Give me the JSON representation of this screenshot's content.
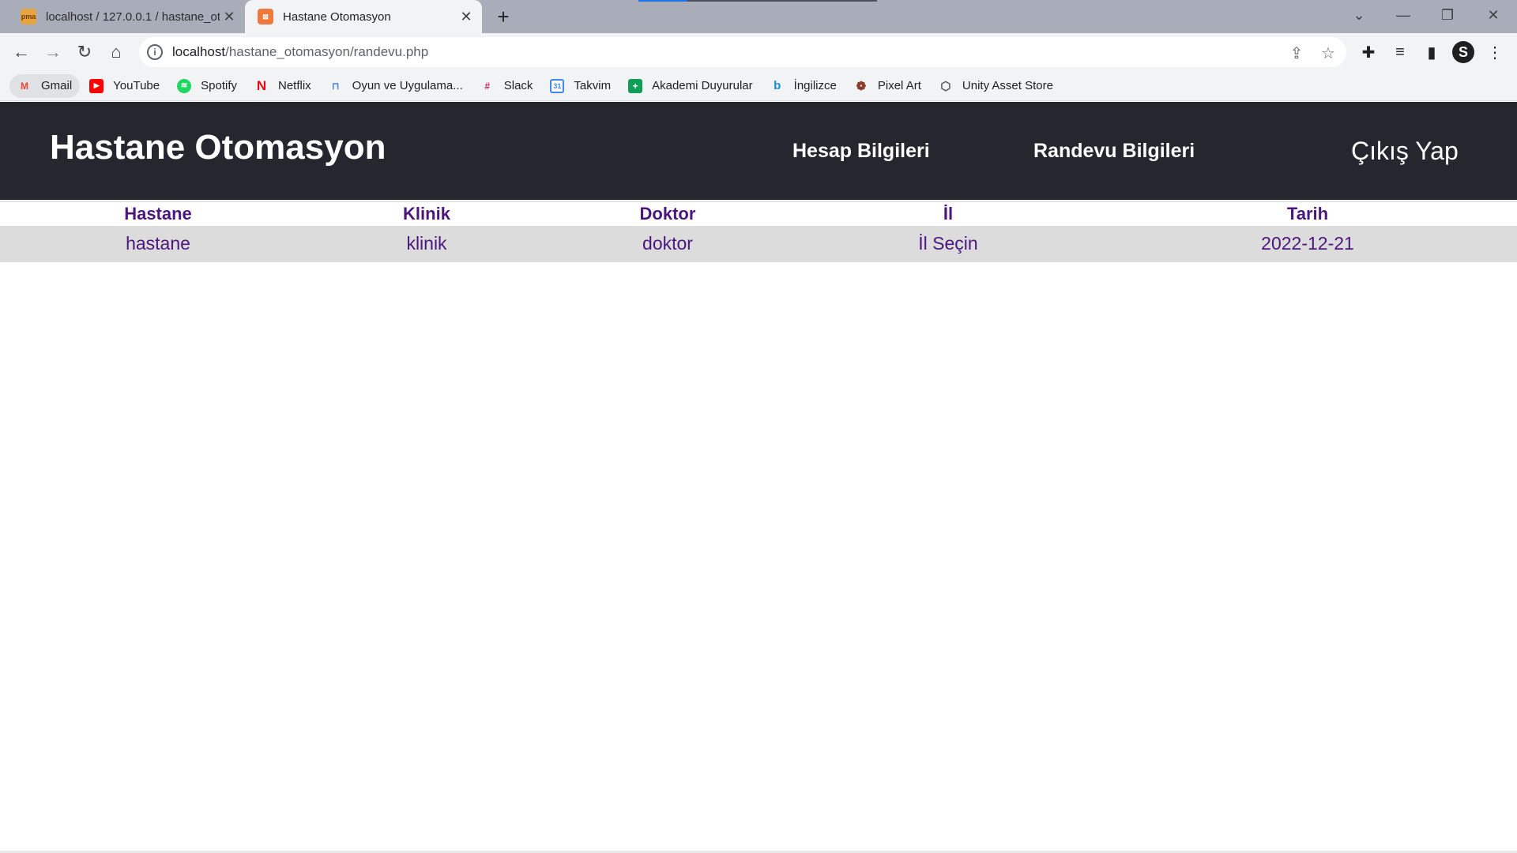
{
  "browser": {
    "tabs": [
      {
        "title": "localhost / 127.0.0.1 / hastane_ot",
        "favicon": "pma",
        "active": false
      },
      {
        "title": "Hastane Otomasyon",
        "favicon": "xampp",
        "active": true
      }
    ],
    "new_tab_symbol": "+",
    "address": {
      "host": "localhost",
      "path": "/hastane_otomasyon/randevu.php"
    },
    "profile_initial": "S",
    "bookmarks": [
      {
        "label": "Gmail",
        "icon": "gmail-icon"
      },
      {
        "label": "YouTube",
        "icon": "youtube-icon"
      },
      {
        "label": "Spotify",
        "icon": "spotify-icon"
      },
      {
        "label": "Netflix",
        "icon": "netflix-icon"
      },
      {
        "label": "Oyun ve Uygulama...",
        "icon": "play-games-icon"
      },
      {
        "label": "Slack",
        "icon": "slack-icon"
      },
      {
        "label": "Takvim",
        "icon": "calendar-icon"
      },
      {
        "label": "Akademi Duyurular",
        "icon": "sheets-icon"
      },
      {
        "label": "İngilizce",
        "icon": "bing-icon"
      },
      {
        "label": "Pixel Art",
        "icon": "pixel-art-icon"
      },
      {
        "label": "Unity Asset Store",
        "icon": "unity-icon"
      }
    ]
  },
  "site": {
    "brand": "Hastane Otomasyon",
    "nav": {
      "account": "Hesap Bilgileri",
      "appointments": "Randevu Bilgileri",
      "logout": "Çıkış Yap"
    }
  },
  "table": {
    "headers": [
      "Hastane",
      "Klinik",
      "Doktor",
      "İl",
      "Tarih"
    ],
    "rows": [
      [
        "hastane",
        "klinik",
        "doktor",
        "İl Seçin",
        "2022-12-21"
      ]
    ]
  },
  "colors": {
    "header_bg": "#26262e",
    "table_text": "#4b177d",
    "row_bg": "#dcdcdc"
  }
}
